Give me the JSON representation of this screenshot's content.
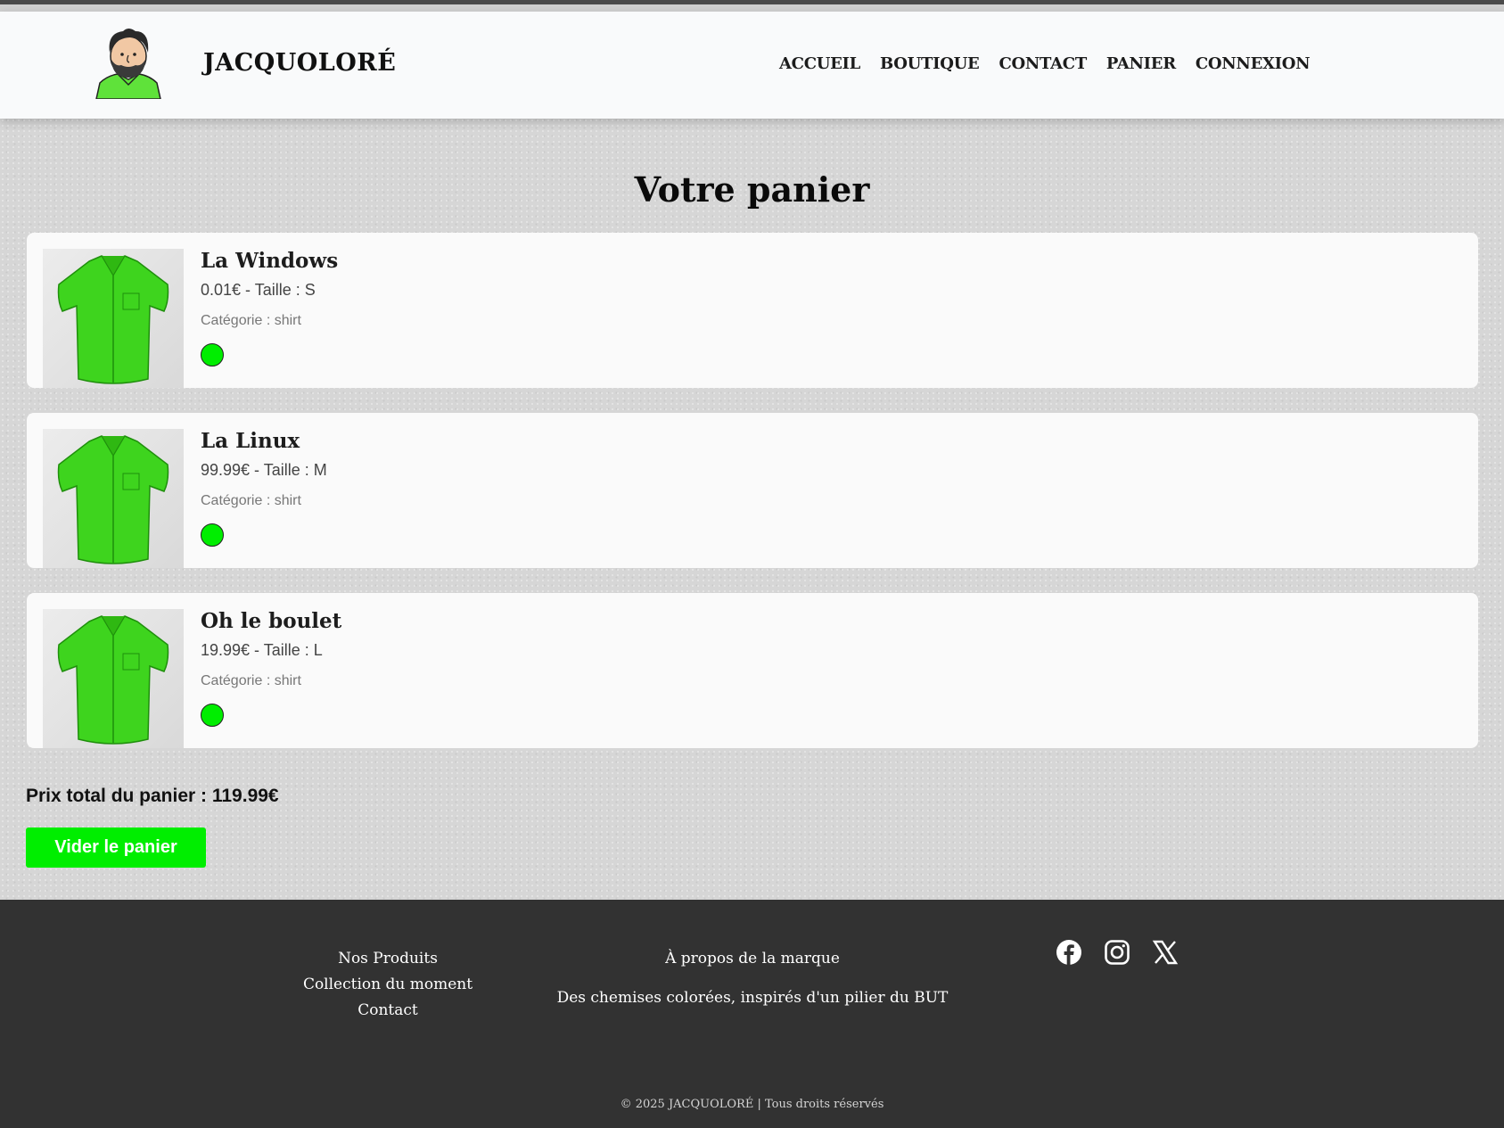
{
  "brand": {
    "name": "JACQUOLORÉ",
    "logo_icon": "caricature-avatar-icon"
  },
  "nav": [
    {
      "label": "ACCUEIL"
    },
    {
      "label": "BOUTIQUE"
    },
    {
      "label": "CONTACT"
    },
    {
      "label": "PANIER"
    },
    {
      "label": "CONNEXION"
    }
  ],
  "page": {
    "title": "Votre panier"
  },
  "cart": {
    "items": [
      {
        "name": "La Windows",
        "price_size": "0.01€ - Taille : S",
        "category": "Catégorie : shirt",
        "color": "#00ee00",
        "image_icon": "green-shirt-image"
      },
      {
        "name": "La Linux",
        "price_size": "99.99€ - Taille : M",
        "category": "Catégorie : shirt",
        "color": "#00ee00",
        "image_icon": "green-shirt-image"
      },
      {
        "name": "Oh le boulet",
        "price_size": "19.99€ - Taille : L",
        "category": "Catégorie : shirt",
        "color": "#00ee00",
        "image_icon": "green-shirt-image"
      }
    ],
    "total_label": "Prix total du panier : 119.99€",
    "clear_button": "Vider le panier",
    "accent_color": "#00ee00"
  },
  "footer": {
    "links": [
      {
        "label": "Nos Produits"
      },
      {
        "label": "Collection du moment"
      },
      {
        "label": "Contact"
      }
    ],
    "about_heading": "À propos de la marque",
    "about_text": "Des chemises colorées, inspirés d'un pilier du BUT",
    "social": [
      {
        "icon": "facebook-icon"
      },
      {
        "icon": "instagram-icon"
      },
      {
        "icon": "x-twitter-icon"
      }
    ],
    "copyright": "© 2025 JACQUOLORÉ | Tous droits réservés"
  }
}
